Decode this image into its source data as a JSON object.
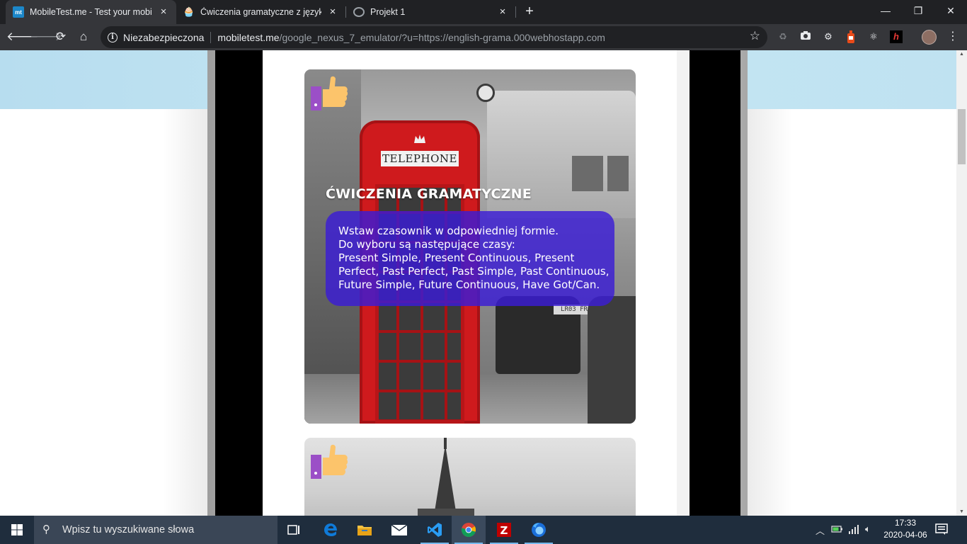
{
  "browser": {
    "tabs": [
      {
        "title": "MobileTest.me - Test your mobile",
        "favicon": "mt",
        "active": true
      },
      {
        "title": "Ćwiczenia gramatyczne z języka a",
        "favicon": "cupcake-icon",
        "active": false
      },
      {
        "title": "Projekt 1",
        "favicon": "globe-icon",
        "active": false
      }
    ],
    "new_tab": "+",
    "window_controls": {
      "minimize": "—",
      "restore": "❐",
      "close": "✕"
    },
    "security_label": "Niezabezpieczona",
    "url_host": "mobiletest.me",
    "url_path": "/google_nexus_7_emulator/?u=https://english-grama.000webhostapp.com"
  },
  "page": {
    "card": {
      "title": "ĆWICZENIA GRAMATYCZNE",
      "lines": [
        "Wstaw czasownik w odpowiedniej formie.",
        "Do wyboru są następujące czasy:",
        "Present Simple, Present Continuous, Present",
        "Perfect, Past Perfect, Past Simple, Past Continuous,",
        "Future Simple, Future Continuous, Have Got/Can."
      ],
      "booth_sign": "TELEPHONE",
      "plate": "LR03 FR"
    }
  },
  "taskbar": {
    "search_placeholder": "Wpisz tu wyszukiwane słowa",
    "time": "17:33",
    "date": "2020-04-06"
  },
  "colors": {
    "accent_box": "#3a1cd6",
    "booth_red": "#cf1a1d",
    "taskbar": "#1f2d3d"
  }
}
